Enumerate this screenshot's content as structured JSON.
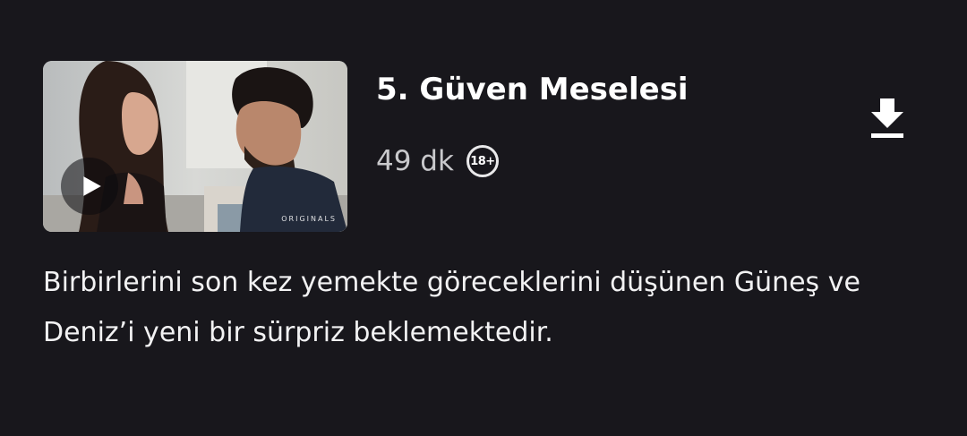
{
  "episode": {
    "title": "5. Güven Meselesi",
    "duration": "49 dk",
    "rating": "18+",
    "description": "Birbirlerini son kez yemekte göreceklerini düşünen Güneş ve Deniz’i yeni bir sürpriz beklemektedir.",
    "thumbnail": {
      "badge": "ORIGINALS"
    }
  },
  "icons": {
    "play": "play-icon",
    "download": "download-icon"
  },
  "colors": {
    "background": "#18171c",
    "text": "#ffffff",
    "muted_text": "#c9c9cc"
  }
}
